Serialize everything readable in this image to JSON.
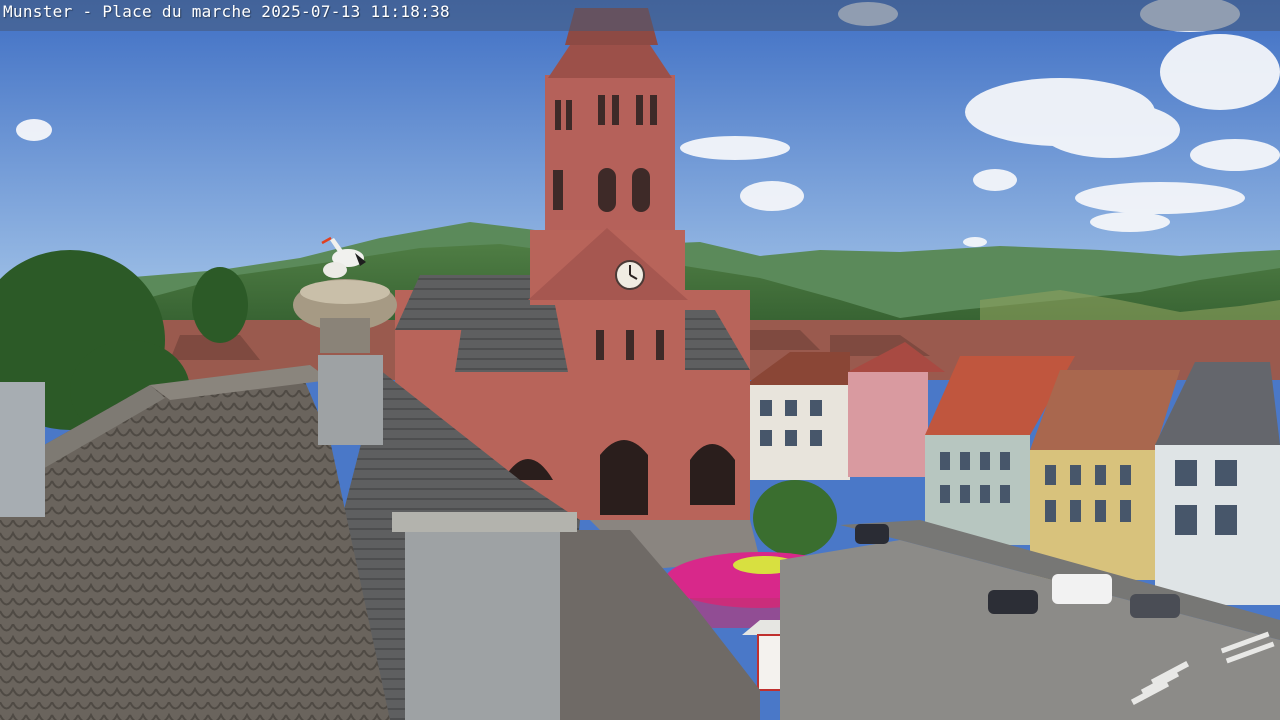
{
  "overlay": {
    "location": "Munster - Place du marche",
    "timestamp": "2025-07-13 11:18:38"
  },
  "colors": {
    "sky_top": "#3f6fc4",
    "sky_bottom": "#a8c8ea",
    "hills": "#3d6b33",
    "sandstone": "#b8645a",
    "roof_tiles": "#6e6a64",
    "market_umbrella": "#d8288a"
  }
}
